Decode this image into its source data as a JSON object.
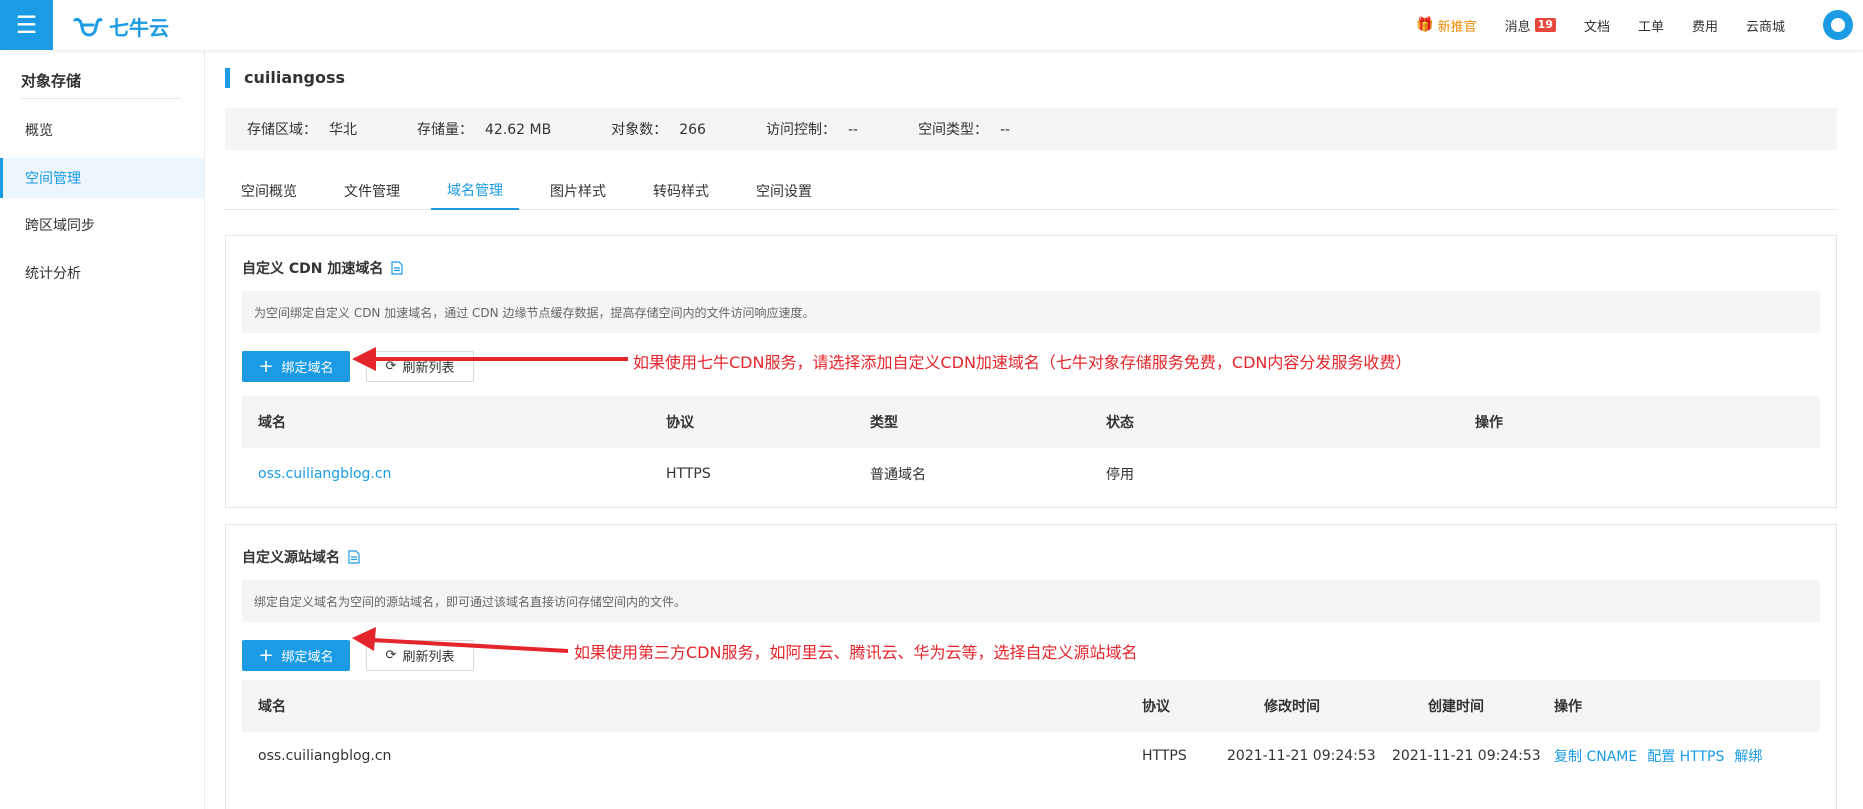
{
  "topbar": {
    "brand": "七牛云",
    "links": [
      {
        "label": "新推官",
        "highlight": true
      },
      {
        "label": "消息",
        "badge": "19"
      },
      {
        "label": "文档"
      },
      {
        "label": "工单"
      },
      {
        "label": "费用"
      },
      {
        "label": "云商城"
      }
    ]
  },
  "sidebar": {
    "title": "对象存储",
    "items": [
      {
        "label": "概览"
      },
      {
        "label": "空间管理",
        "active": true
      },
      {
        "label": "跨区域同步"
      },
      {
        "label": "统计分析"
      }
    ]
  },
  "bucket": {
    "name": "cuiliangoss",
    "info": [
      {
        "key": "存储区域：",
        "value": "华北"
      },
      {
        "key": "存储量：",
        "value": "42.62 MB"
      },
      {
        "key": "对象数：",
        "value": "266"
      },
      {
        "key": "访问控制：",
        "value": "--"
      },
      {
        "key": "空间类型：",
        "value": "--"
      }
    ]
  },
  "tabs": [
    {
      "label": "空间概览"
    },
    {
      "label": "文件管理"
    },
    {
      "label": "域名管理",
      "active": true
    },
    {
      "label": "图片样式"
    },
    {
      "label": "转码样式"
    },
    {
      "label": "空间设置"
    }
  ],
  "cdn_panel": {
    "title": "自定义 CDN 加速域名",
    "desc": "为空间绑定自定义 CDN 加速域名，通过 CDN 边缘节点缓存数据，提高存储空间内的文件访问响应速度。",
    "bind_label": "绑定域名",
    "refresh_label": "刷新列表",
    "annotation": "如果使用七牛CDN服务，请选择添加自定义CDN加速域名（七牛对象存储服务免费，CDN内容分发服务收费）",
    "columns": [
      "域名",
      "协议",
      "类型",
      "状态",
      "操作"
    ],
    "rows": [
      {
        "domain": "oss.cuiliangblog.cn",
        "protocol": "HTTPS",
        "type": "普通域名",
        "status": "停用"
      }
    ]
  },
  "source_panel": {
    "title": "自定义源站域名",
    "desc": "绑定自定义域名为空间的源站域名，即可通过该域名直接访问存储空间内的文件。",
    "bind_label": "绑定域名",
    "refresh_label": "刷新列表",
    "annotation": "如果使用第三方CDN服务，如阿里云、腾讯云、华为云等，选择自定义源站域名",
    "columns": [
      "域名",
      "协议",
      "修改时间",
      "创建时间",
      "操作"
    ],
    "rows": [
      {
        "domain": "oss.cuiliangblog.cn",
        "protocol": "HTTPS",
        "modified": "2021-11-21 09:24:53",
        "created": "2021-11-21 09:24:53",
        "ops": [
          "复制 CNAME",
          "配置 HTTPS",
          "解绑"
        ]
      }
    ]
  },
  "colors": {
    "accent": "#1a9be4",
    "annotation": "#e5252c",
    "highlight": "#f08a00",
    "badge": "#e8473c"
  }
}
